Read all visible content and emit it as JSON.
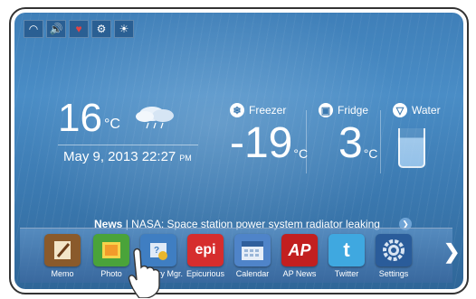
{
  "status_icons": [
    "wifi-icon",
    "speaker-icon",
    "alert-icon",
    "settings-icon",
    "light-icon"
  ],
  "weather": {
    "temp": "16",
    "unit": "°C",
    "date_time": "May 9, 2013 22:27",
    "ampm": "PM"
  },
  "zones": [
    {
      "label": "Freezer",
      "value": "-19",
      "unit": "°C",
      "icon": "snowflake-icon"
    },
    {
      "label": "Fridge",
      "value": "3",
      "unit": "°C",
      "icon": "fridge-icon"
    },
    {
      "label": "Water",
      "icon": "water-icon"
    }
  ],
  "news": {
    "title": "News",
    "separator": "|",
    "text": "NASA: Space station power system radiator leaking"
  },
  "apps": [
    {
      "label": "Memo",
      "color": "#8a5a2b"
    },
    {
      "label": "Photo",
      "color": "#4aa33a"
    },
    {
      "label": "Grocery Mgr.",
      "color": "#3f7ec2"
    },
    {
      "label": "Epicurious",
      "color": "#d62d2d",
      "text": "epi"
    },
    {
      "label": "Calendar",
      "color": "#4f84c9"
    },
    {
      "label": "AP News",
      "color": "#c21f1f",
      "text": "AP"
    },
    {
      "label": "Twitter",
      "color": "#3fa8e0",
      "text": "t"
    },
    {
      "label": "Settings",
      "color": "#2a5c9a"
    }
  ]
}
